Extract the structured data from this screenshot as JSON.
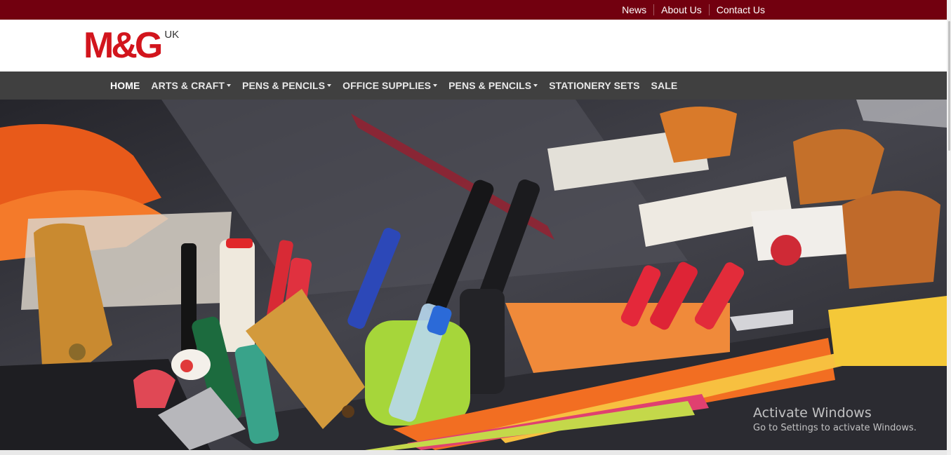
{
  "topbar": {
    "links": [
      "News",
      "About Us",
      "Contact Us"
    ]
  },
  "logo": {
    "mark": "M&G",
    "region": "UK"
  },
  "nav": {
    "items": [
      {
        "label": "HOME",
        "dropdown": false,
        "active": true
      },
      {
        "label": "ARTS & CRAFT",
        "dropdown": true,
        "active": false
      },
      {
        "label": "PENS & PENCILS",
        "dropdown": true,
        "active": false
      },
      {
        "label": "OFFICE SUPPLIES",
        "dropdown": true,
        "active": false
      },
      {
        "label": "PENS & PENCILS",
        "dropdown": true,
        "active": false
      },
      {
        "label": "STATIONERY SETS",
        "dropdown": false,
        "active": false
      },
      {
        "label": "SALE",
        "dropdown": false,
        "active": false
      }
    ]
  },
  "watermark": {
    "title": "Activate Windows",
    "subtitle": "Go to Settings to activate Windows."
  },
  "colors": {
    "topbar": "#72000f",
    "brand_red": "#d2151d",
    "nav_bg": "#404040"
  },
  "icons": {
    "dropdown": "caret-down-icon"
  }
}
